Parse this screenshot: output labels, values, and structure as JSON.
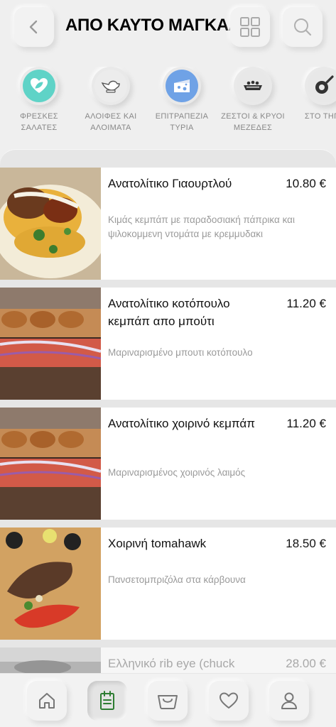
{
  "header": {
    "title": "ΑΠΟ ΚΑΥΤΟ ΜΑΓΚΑΛΙ",
    "back_icon": "chevron-left-icon",
    "grid_icon": "grid-view-icon",
    "search_icon": "search-icon"
  },
  "categories": [
    {
      "label": "ΦΡΕΣΚΕΣ\nΣΑΛΑΤΕΣ",
      "icon": "heart-leaf-icon",
      "color": "#5fd3c7"
    },
    {
      "label": "ΑΛΟΙΦΕΣ ΚΑΙ\nΑΛΟΙΜΑΤΑ",
      "icon": "gravy-boat-icon",
      "color": "#ececec"
    },
    {
      "label": "ΕΠΙΤΡΑΠΕΖΙΑ\nΤΥΡΙΑ",
      "icon": "cheese-icon",
      "color": "#6fa2e6"
    },
    {
      "label": "ΖΕΣΤΟΙ & ΚΡΥΟΙ\nΜΕΖΕΔΕΣ",
      "icon": "meze-dish-icon",
      "color": "#e8e8e8"
    },
    {
      "label": "ΣΤΟ ΤΗΓΑ",
      "icon": "frying-pan-icon",
      "color": "#e8e8e8"
    }
  ],
  "items": [
    {
      "name": "Ανατολίτικο Γιαουρτλού",
      "price": "10.80 €",
      "description": "Κιμάς κεμπάπ με παραδοσιακή πάπρικα και ψιλοκομμενη ντομάτα με κρεμμυδακι"
    },
    {
      "name": "Ανατολίτικο κοτόπουλο κεμπάπ απο μπούτι",
      "price": "11.20 €",
      "description": "Μαριναρισμένο μπουτι κοτόπουλο"
    },
    {
      "name": "Ανατολίτικο χοιρινό κεμπάπ",
      "price": "11.20 €",
      "description": "Μαριναρισμένος χοιρινός λαιμός"
    },
    {
      "name": "Χοιρινή tomahawk",
      "price": "18.50 €",
      "description": "Πανσετομπριζόλα στα κάρβουνα"
    },
    {
      "name": "Ελληνικό rib eye (chuck",
      "price": "28.00 €",
      "description": ""
    }
  ],
  "bottom_nav": [
    {
      "icon": "home-icon",
      "active": false
    },
    {
      "icon": "menu-icon",
      "active": true
    },
    {
      "icon": "basket-icon",
      "active": false
    },
    {
      "icon": "heart-icon",
      "active": false
    },
    {
      "icon": "user-icon",
      "active": false
    }
  ],
  "colors": {
    "accent_green": "#2e7d32",
    "background": "#efefef"
  }
}
